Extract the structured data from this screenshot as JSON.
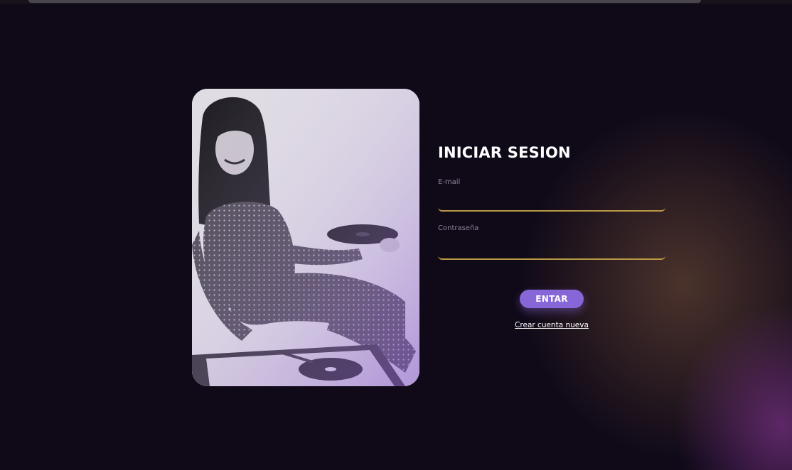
{
  "login": {
    "title": "INICIAR SESION",
    "email_label": "E-mail",
    "email_value": "",
    "password_label": "Contraseña",
    "password_value": "",
    "submit_label": "ENTAR",
    "create_account_label": "Crear cuenta nueva"
  },
  "colors": {
    "background": "#0f0918",
    "accent_button": "#8766d8",
    "input_underline": "#b89a45",
    "glow_purple": "#7a3282",
    "glow_amber": "#7d553c"
  }
}
